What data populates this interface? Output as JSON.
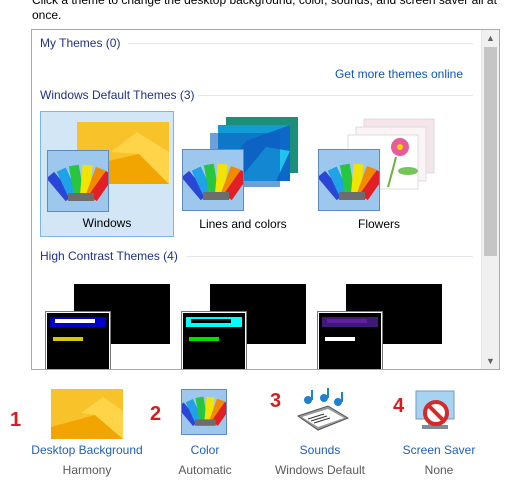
{
  "intro_text": "Click a theme to change the desktop background, color, sounds, and screen saver all at once.",
  "panel": {
    "my_themes_header": "My Themes (0)",
    "get_more_link": "Get more themes online",
    "default_header": "Windows Default Themes (3)",
    "default_themes": [
      {
        "label": "Windows",
        "selected": true
      },
      {
        "label": "Lines and colors",
        "selected": false
      },
      {
        "label": "Flowers",
        "selected": false
      }
    ],
    "high_contrast_header": "High Contrast Themes (4)",
    "high_contrast_themes": [
      {
        "name": "",
        "bar_color": "#ffffff",
        "accent_color": "#d8c800",
        "bg_bar": "#0000cc"
      },
      {
        "name": "",
        "bar_color": "#00ffff",
        "accent_color": "#00e000",
        "bg_bar": "#00ffff"
      },
      {
        "name": "",
        "bar_color": "#6020a0",
        "accent_color": "#ffffff",
        "bg_bar": "#401878"
      }
    ]
  },
  "bottom": {
    "items": [
      {
        "number": "1",
        "label": "Desktop Background",
        "value": "Harmony",
        "icon": "desktop-background-icon"
      },
      {
        "number": "2",
        "label": "Color",
        "value": "Automatic",
        "icon": "color-palette-icon"
      },
      {
        "number": "3",
        "label": "Sounds",
        "value": "Windows Default",
        "icon": "sounds-icon"
      },
      {
        "number": "4",
        "label": "Screen Saver",
        "value": "None",
        "icon": "screen-saver-icon"
      }
    ]
  },
  "colors": {
    "header_blue": "#1e3287",
    "link_blue": "#0d55b5",
    "selected_bg": "#d2e6f6",
    "number_red": "#d21f1f"
  }
}
